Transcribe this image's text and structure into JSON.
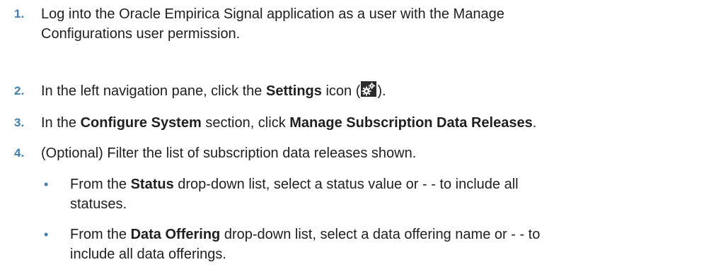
{
  "steps": [
    {
      "num": "1.",
      "lines": [
        "Log into the Oracle Empirica Signal application as a user with the Manage",
        "Configurations user permission."
      ]
    },
    {
      "num": "2.",
      "pre": "In the left navigation pane, click the ",
      "bold": "Settings",
      "mid": " icon (",
      "icon": "settings-gear-icon",
      "post": ")."
    },
    {
      "num": "3.",
      "pre": "In the ",
      "bold1": "Configure System",
      "mid": " section, click ",
      "bold2": "Manage Subscription Data Releases",
      "post": "."
    },
    {
      "num": "4.",
      "text": "(Optional) Filter the list of subscription data releases shown."
    }
  ],
  "bullets": [
    {
      "symbol": "•",
      "pre": "From the ",
      "bold": "Status",
      "line1_rest": " drop-down list, select a status value or - - to include all",
      "line2": "statuses."
    },
    {
      "symbol": "•",
      "pre": "From the ",
      "bold": "Data Offering",
      "line1_rest": " drop-down list, select a data offering name or - - to",
      "line2": "include all data offerings."
    }
  ],
  "colors": {
    "number": "#3d7fb5",
    "text": "#1f1f1f",
    "icon_bg": "#2b2b2b"
  }
}
